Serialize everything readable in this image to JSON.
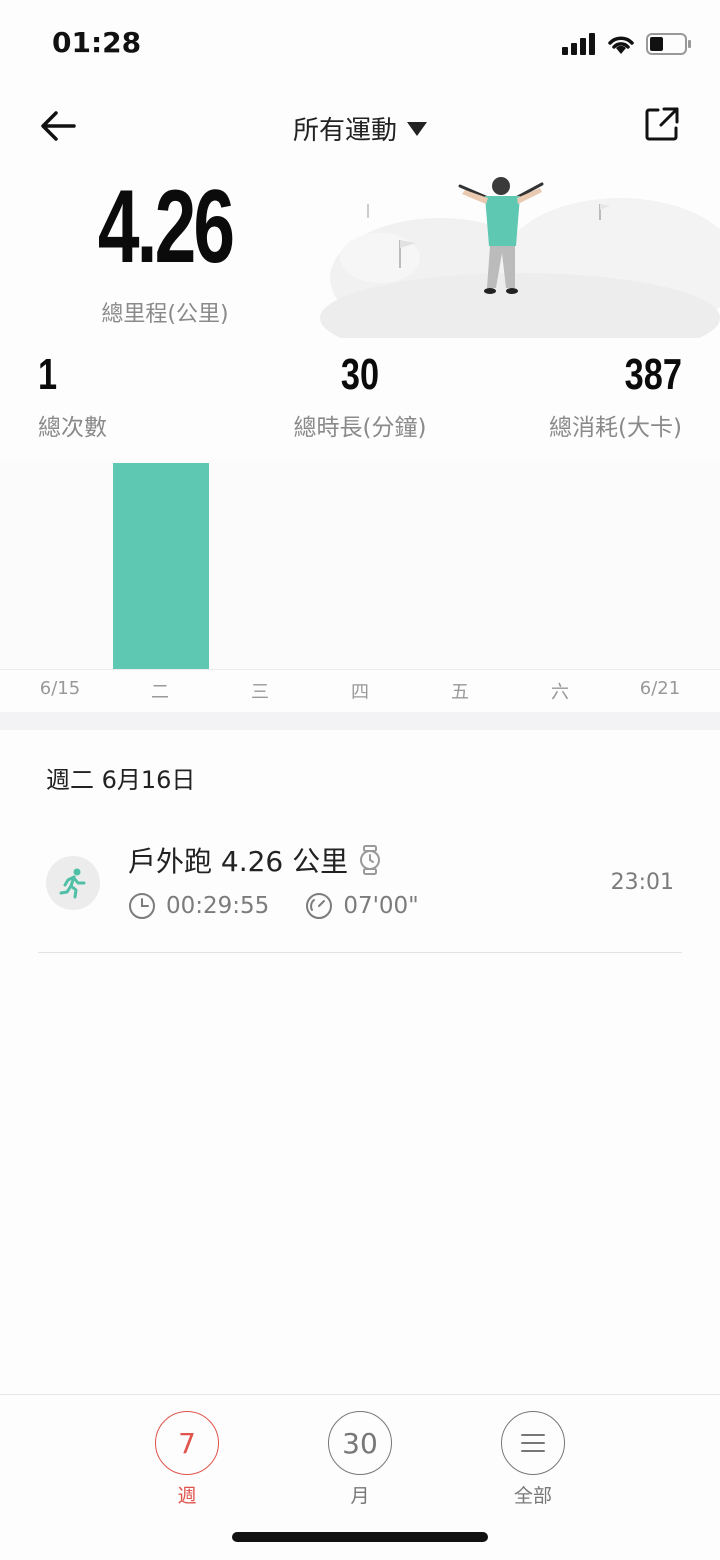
{
  "status_bar": {
    "time": "01:28"
  },
  "nav": {
    "title": "所有運動"
  },
  "summary": {
    "total_distance": "4.26",
    "total_distance_label": "總里程(公里)",
    "count": "1",
    "count_label": "總次數",
    "duration": "30",
    "duration_label": "總時長(分鐘)",
    "calories": "387",
    "calories_label": "總消耗(大卡)"
  },
  "chart_data": {
    "type": "bar",
    "categories": [
      "6/15",
      "二",
      "三",
      "四",
      "五",
      "六",
      "6/21"
    ],
    "values": [
      0,
      4.26,
      0,
      0,
      0,
      0,
      0
    ],
    "title": "",
    "xlabel": "",
    "ylabel": "",
    "ylim": [
      0,
      4.26
    ],
    "grid": false,
    "bar_color": "#5ec8b3"
  },
  "list": {
    "day_header": "週二 6月16日",
    "entries": [
      {
        "title": "戶外跑 4.26 公里",
        "duration": "00:29:55",
        "pace": "07'00\"",
        "time": "23:01",
        "icon": "running-icon"
      }
    ]
  },
  "tabs": [
    {
      "num": "7",
      "label": "週",
      "active": true
    },
    {
      "num": "30",
      "label": "月",
      "active": false
    },
    {
      "num": "",
      "label": "全部",
      "active": false,
      "icon": "menu-icon"
    }
  ],
  "colors": {
    "accent": "#5ec8b3",
    "active_tab": "#e0544e"
  }
}
